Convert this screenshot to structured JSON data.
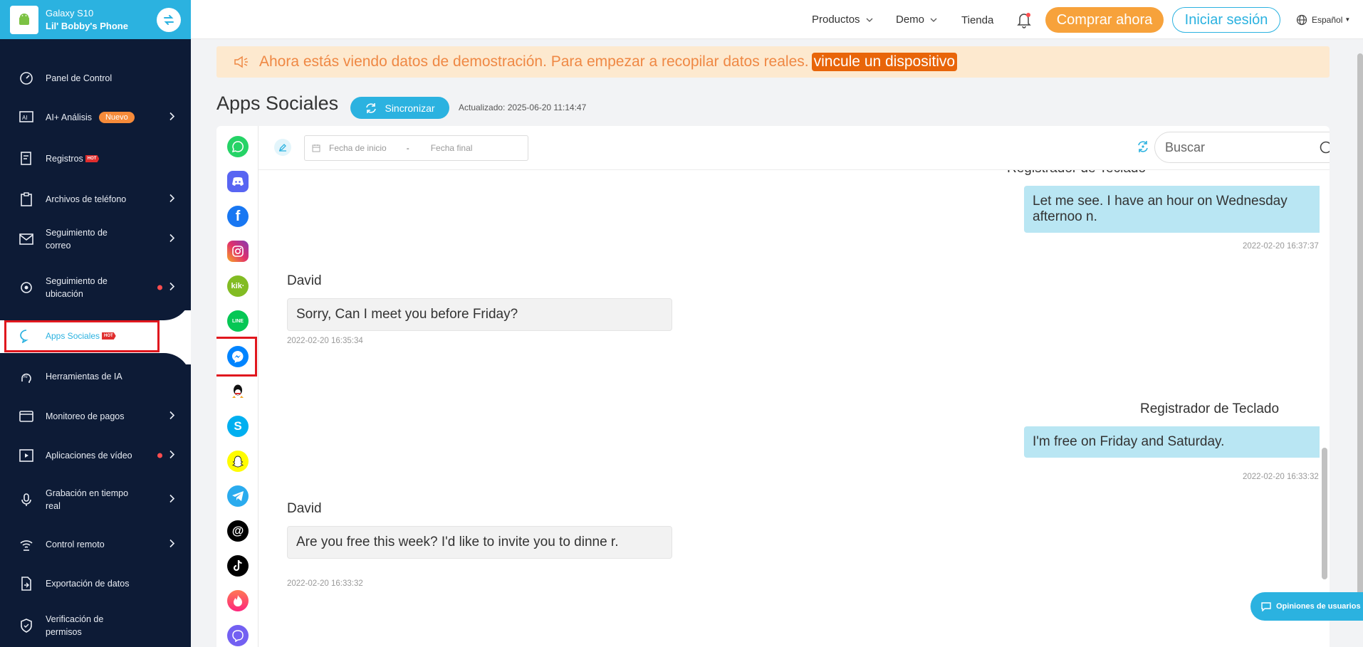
{
  "device": {
    "name": "Galaxy S10",
    "owner": "Lil' Bobby's Phone"
  },
  "sidebar": {
    "items": [
      {
        "label": "Panel de Control"
      },
      {
        "label": "AI+ Análisis",
        "badge": "Nuevo"
      },
      {
        "label": "Registros",
        "hot": "HOT"
      },
      {
        "label": "Archivos de teléfono"
      },
      {
        "label": "Seguimiento de correo"
      },
      {
        "label": "Seguimiento de ubicación"
      },
      {
        "label": "Apps Sociales",
        "hot": "HOT"
      },
      {
        "label": "Herramientas de IA"
      },
      {
        "label": "Monitoreo de pagos"
      },
      {
        "label": "Aplicaciones de vídeo"
      },
      {
        "label": "Grabación en tiempo real"
      },
      {
        "label": "Control remoto"
      },
      {
        "label": "Exportación de datos"
      },
      {
        "label": "Verificación de permisos"
      }
    ]
  },
  "header": {
    "products": "Productos",
    "demo": "Demo",
    "store": "Tienda",
    "buy": "Comprar ahora",
    "login": "Iniciar sesión",
    "language": "Español"
  },
  "banner": {
    "text": "Ahora estás viendo datos de demostración. Para empezar a recopilar datos reales.",
    "link": "vincule un dispositivo"
  },
  "page": {
    "title": "Apps Sociales",
    "sync": "Sincronizar",
    "updated": "Actualizado: 2025-06-20 11:14:47"
  },
  "toolbar": {
    "start_placeholder": "Fecha de inicio",
    "end_placeholder": "Fecha final",
    "search_placeholder": "Buscar"
  },
  "chat": {
    "top_sender": "Registrador de Teclado",
    "messages": [
      {
        "text": "Let me see. I have an hour on Wednesday afternoo n.",
        "time": "2022-02-20 16:37:37"
      },
      {
        "sender": "David",
        "text": "Sorry, Can I meet you before Friday?",
        "time": "2022-02-20 16:35:34"
      },
      {
        "sender": "Registrador de Teclado",
        "text": "I'm free on Friday and Saturday.",
        "time": "2022-02-20 16:33:32"
      },
      {
        "sender": "David",
        "text": "Are you free this week? I'd like to invite you to dinne r.",
        "time": "2022-02-20 16:33:32"
      }
    ]
  },
  "feedback": {
    "label": "Opiniones de usuarios"
  },
  "colors": {
    "accent": "#2bb2e0",
    "sidebar": "#0d1b36",
    "buy": "#f7a23b",
    "highlight": "#e0171e"
  },
  "apps": [
    "whatsapp-icon",
    "discord-icon",
    "facebook-icon",
    "instagram-icon",
    "kik-icon",
    "line-icon",
    "messenger-icon",
    "qq-icon",
    "skype-icon",
    "snapchat-icon",
    "telegram-icon",
    "threads-icon",
    "tiktok-icon",
    "tinder-icon",
    "viber-icon"
  ]
}
